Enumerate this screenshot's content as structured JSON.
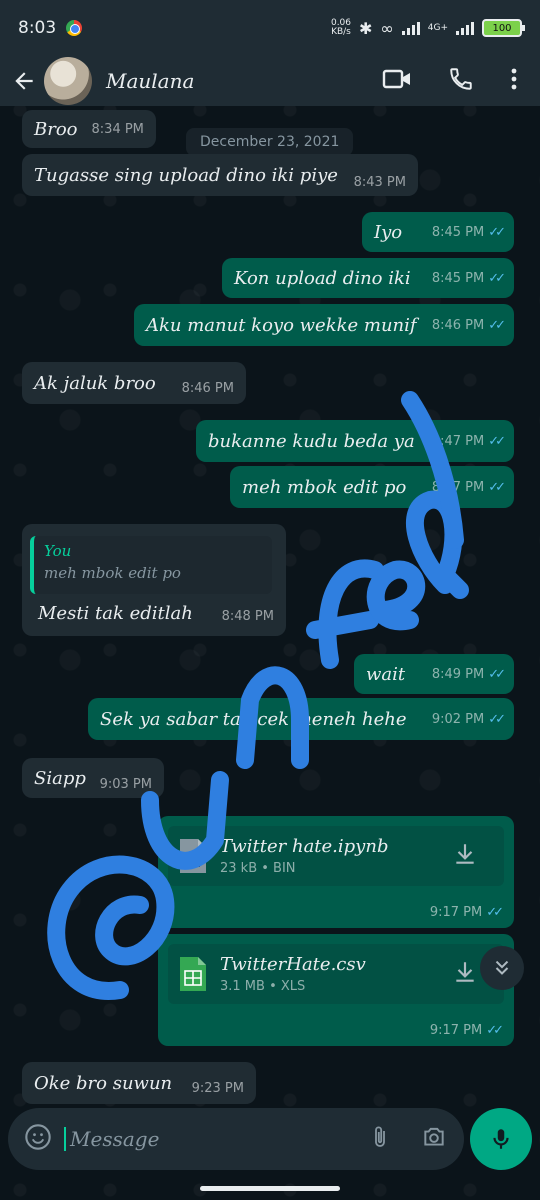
{
  "status": {
    "time": "8:03",
    "net_speed_top": "0.06",
    "net_speed_bottom": "KB/s",
    "network": "4G+",
    "battery": "100"
  },
  "header": {
    "contact_name": "Maulana"
  },
  "date_pill": "December 23, 2021",
  "messages": [
    {
      "text": "Broo",
      "time": "8:34 PM"
    },
    {
      "text": "Tugasse sing upload dino iki piye",
      "time": "8:43 PM"
    },
    {
      "text": "Iyo",
      "time": "8:45 PM"
    },
    {
      "text": "Kon upload dino iki",
      "time": "8:45 PM"
    },
    {
      "text": "Aku manut koyo wekke munif",
      "time": "8:46 PM"
    },
    {
      "text": "Ak jaluk broo",
      "time": "8:46 PM"
    },
    {
      "text": "bukanne kudu beda ya",
      "time": "8:47 PM"
    },
    {
      "text": "meh mbok edit po",
      "time": "8:47 PM"
    },
    {
      "text": "Mesti tak editlah",
      "time": "8:48 PM",
      "quote_author": "You",
      "quote_text": "meh mbok edit po"
    },
    {
      "text": "wait",
      "time": "8:49 PM"
    },
    {
      "text": "Sek ya sabar tak cek meneh hehe",
      "time": "9:02 PM"
    },
    {
      "text": "Siapp",
      "time": "9:03 PM"
    },
    {
      "text": "Oke bro suwun",
      "time": "9:23 PM"
    }
  ],
  "files": [
    {
      "name": "Twitter hate.ipynb",
      "meta": "23 kB • BIN",
      "badge": "BIN",
      "time": "9:17 PM"
    },
    {
      "name": "TwitterHate.csv",
      "meta": "3.1 MB • XLS",
      "time": "9:17 PM"
    }
  ],
  "input": {
    "placeholder": "Message"
  },
  "watermark": {
    "text": "@unfeal",
    "color": "#2f7fe0"
  },
  "colors": {
    "incoming": "#202c33",
    "outgoing": "#005c4b",
    "accent": "#00a884",
    "read_ticks": "#53bdeb"
  }
}
